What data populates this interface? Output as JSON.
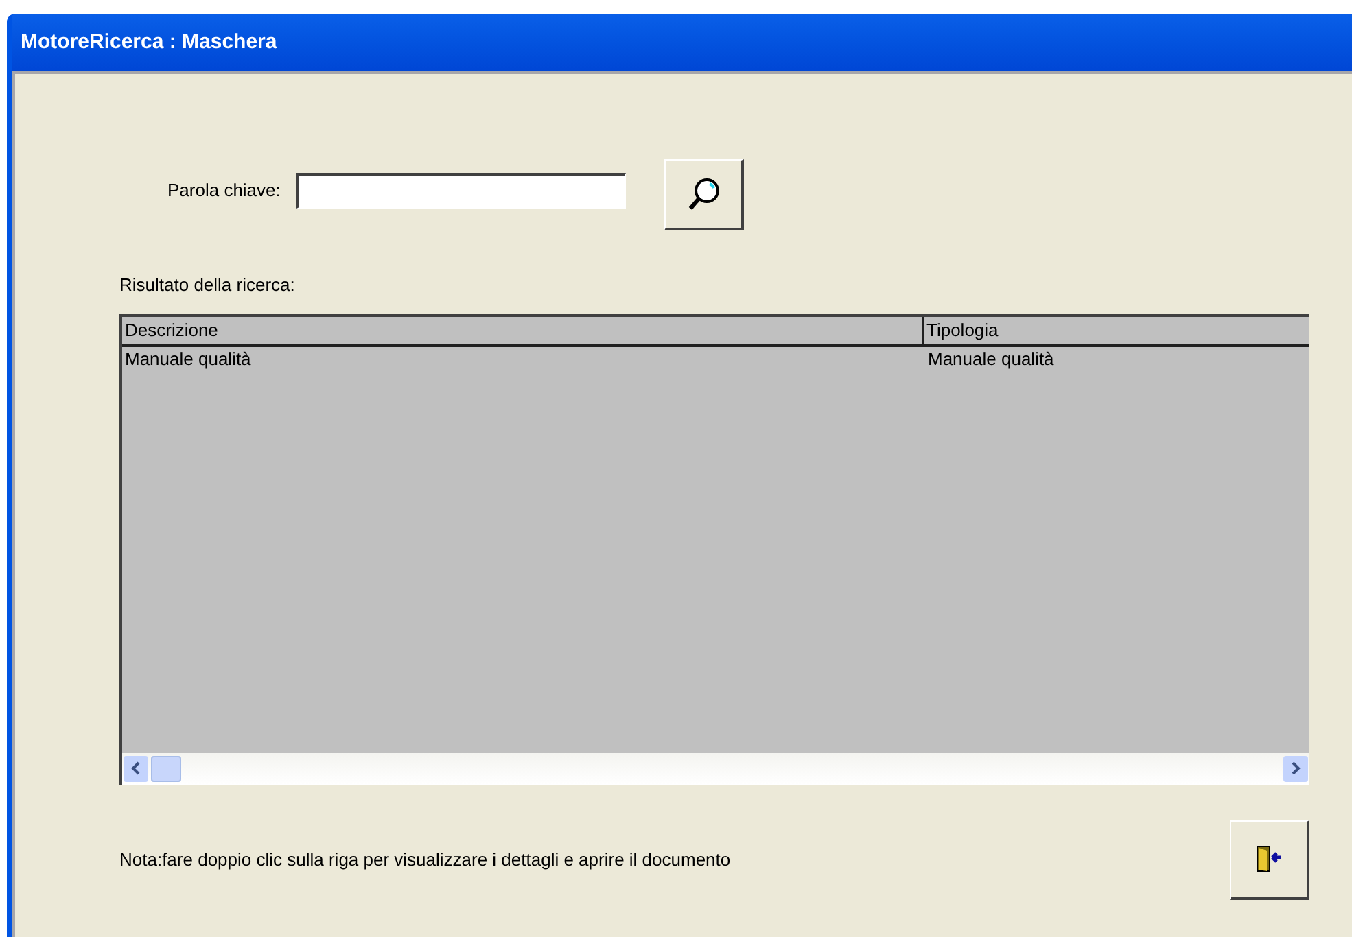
{
  "window": {
    "title": "MotoreRicerca : Maschera"
  },
  "search": {
    "label": "Parola chiave:"
  },
  "results": {
    "label": "Risultato della ricerca:",
    "columns": [
      "Descrizione",
      "Tipologia"
    ],
    "rows": [
      [
        "Manuale qualità",
        "Manuale qualità"
      ]
    ]
  },
  "note": "Nota:fare doppio clic sulla riga per visualizzare i dettagli e aprire il documento"
}
